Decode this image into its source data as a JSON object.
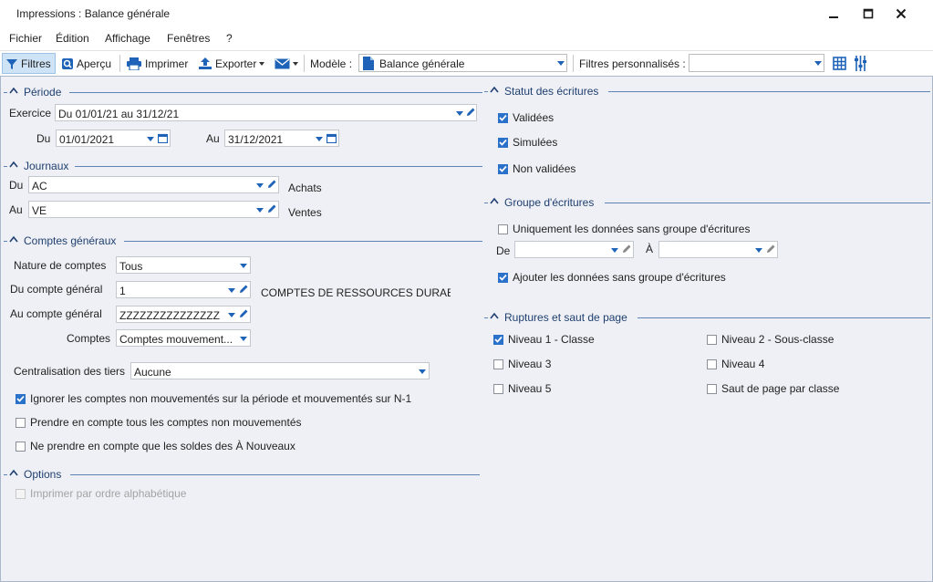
{
  "window": {
    "title": "Impressions : Balance générale"
  },
  "menu": {
    "items": [
      "Fichier",
      "Édition",
      "Affichage",
      "Fenêtres",
      "?"
    ]
  },
  "toolbar": {
    "filtres": "Filtres",
    "apercu": "Aperçu",
    "imprimer": "Imprimer",
    "exporter": "Exporter",
    "modele_label": "Modèle :",
    "modele_value": "Balance générale",
    "filtres_perso_label": "Filtres personnalisés :",
    "filtres_perso_value": ""
  },
  "periode": {
    "title": "Période",
    "exercice_label": "Exercice",
    "exercice_value": "Du 01/01/21 au 31/12/21",
    "du_label": "Du",
    "du_value": "01/01/2021",
    "au_label": "Au",
    "au_value": "31/12/2021"
  },
  "journaux": {
    "title": "Journaux",
    "du_label": "Du",
    "du_value": "AC",
    "du_desc": "Achats",
    "au_label": "Au",
    "au_value": "VE",
    "au_desc": "Ventes"
  },
  "comptes": {
    "title": "Comptes généraux",
    "nature_label": "Nature de comptes",
    "nature_value": "Tous",
    "du_label": "Du compte général",
    "du_value": "1",
    "du_desc": "COMPTES DE RESSOURCES DURABLES",
    "au_label": "Au compte général",
    "au_value": "ZZZZZZZZZZZZZZZ",
    "comptes_label": "Comptes",
    "comptes_value": "Comptes mouvement...",
    "centralisation_label": "Centralisation des tiers",
    "centralisation_value": "Aucune",
    "checks": [
      {
        "label": "Ignorer les comptes non mouvementés sur la période et mouvementés sur N-1",
        "checked": true
      },
      {
        "label": "Prendre en compte tous les comptes non mouvementés",
        "checked": false
      },
      {
        "label": "Ne prendre en compte que les soldes des À Nouveaux",
        "checked": false
      }
    ]
  },
  "options": {
    "title": "Options",
    "checks": [
      {
        "label": "Imprimer par ordre alphabétique",
        "checked": false,
        "disabled": true
      }
    ]
  },
  "statut": {
    "title": "Statut des écritures",
    "checks": [
      {
        "label": "Validées",
        "checked": true
      },
      {
        "label": "Simulées",
        "checked": true
      },
      {
        "label": "Non validées",
        "checked": true
      }
    ]
  },
  "groupe": {
    "title": "Groupe d'écritures",
    "uniquement": {
      "label": "Uniquement les données sans groupe d'écritures",
      "checked": false
    },
    "de_label": "De",
    "de_value": "",
    "a_label": "À",
    "a_value": "",
    "ajouter": {
      "label": "Ajouter les données sans groupe d'écritures",
      "checked": true
    }
  },
  "ruptures": {
    "title": "Ruptures et saut de page",
    "checks": [
      {
        "label": "Niveau 1 - Classe",
        "checked": true
      },
      {
        "label": "Niveau 2 - Sous-classe",
        "checked": false
      },
      {
        "label": "Niveau 3",
        "checked": false
      },
      {
        "label": "Niveau 4",
        "checked": false
      },
      {
        "label": "Niveau 5",
        "checked": false
      },
      {
        "label": "Saut de page par classe",
        "checked": false
      }
    ]
  },
  "colors": {
    "accent": "#1e63b8",
    "section_title": "#1f3f70",
    "section_line": "#5d84b5",
    "panel_bg": "#eef0f5",
    "check_on": "#2a71c9"
  }
}
